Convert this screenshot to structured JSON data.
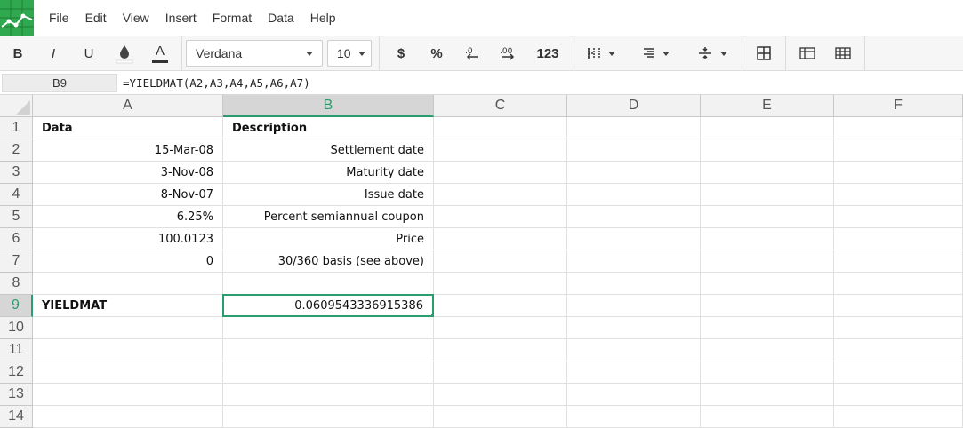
{
  "menu": {
    "items": [
      "File",
      "Edit",
      "View",
      "Insert",
      "Format",
      "Data",
      "Help"
    ]
  },
  "toolbar": {
    "bold": "B",
    "italic": "I",
    "underline": "U",
    "text_color": "A",
    "font": "Verdana",
    "font_size": "10",
    "currency": "$",
    "percent": "%",
    "number_format": "123"
  },
  "formula_bar": {
    "name_box": "B9",
    "formula": "=YIELDMAT(A2,A3,A4,A5,A6,A7)"
  },
  "grid": {
    "columns": [
      "A",
      "B",
      "C",
      "D",
      "E",
      "F"
    ],
    "rows": [
      "1",
      "2",
      "3",
      "4",
      "5",
      "6",
      "7",
      "8",
      "9",
      "10",
      "11",
      "12",
      "13",
      "14"
    ],
    "selected_column": "B",
    "selected_row": "9",
    "cells": {
      "A1": "Data",
      "B1": "Description",
      "A2": "15-Mar-08",
      "B2": "Settlement date",
      "A3": "3-Nov-08",
      "B3": "Maturity date",
      "A4": "8-Nov-07",
      "B4": "Issue date",
      "A5": "6.25%",
      "B5": "Percent semiannual coupon",
      "A6": "100.0123",
      "B6": "Price",
      "A7": "0",
      "B7": "30/360 basis (see above)",
      "A9": "YIELDMAT",
      "B9": "0.0609543336915386"
    }
  },
  "colors": {
    "brand": "#2fa84f",
    "selection": "#2a9d6f"
  }
}
